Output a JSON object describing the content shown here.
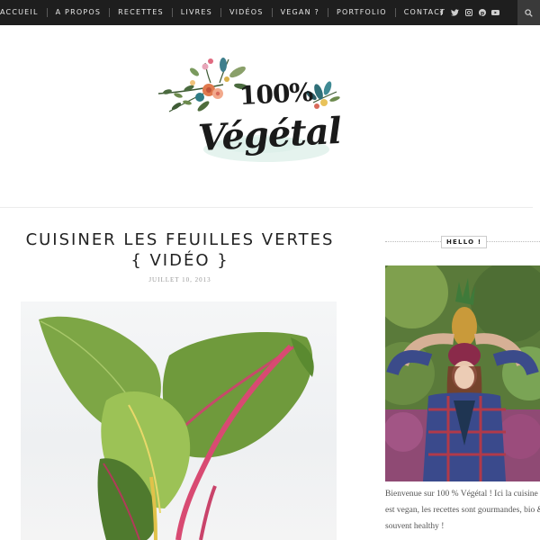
{
  "nav": {
    "items": [
      "ACCUEIL",
      "A PROPOS",
      "RECETTES",
      "LIVRES",
      "VIDÉOS",
      "VEGAN ?",
      "PORTFOLIO",
      "CONTACT"
    ],
    "social_icons": [
      "facebook-icon",
      "twitter-icon",
      "instagram-icon",
      "pinterest-icon",
      "youtube-icon"
    ],
    "search_icon": "search-icon"
  },
  "logo": {
    "pct": "100%",
    "name": "Végétal"
  },
  "post": {
    "title": "CUISINER LES FEUILLES VERTES { VIDÉO }",
    "date": "JUILLET 10, 2013"
  },
  "sidebar": {
    "widget_title": "HELLO !",
    "bio": "Bienvenue sur 100 % Végétal ! Ici la cuisine est vegan, les recettes sont gourmandes, bio & souvent healthy !"
  },
  "colors": {
    "topbar": "#1e1e1e",
    "search_box": "#3a3a3a",
    "text": "#222222"
  }
}
